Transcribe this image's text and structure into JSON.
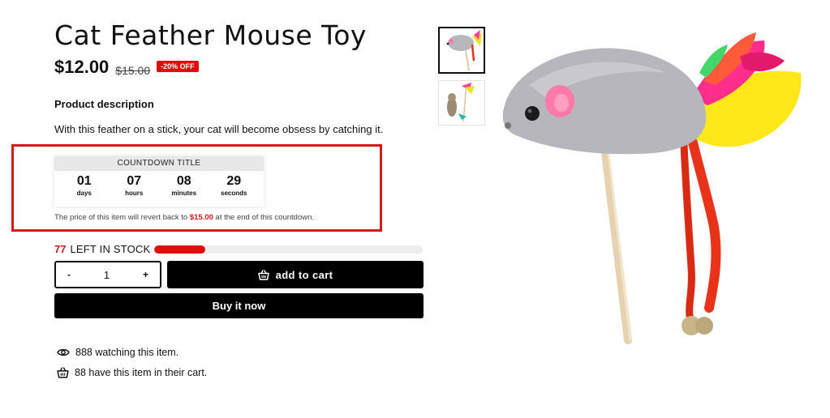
{
  "product": {
    "title": "Cat Feather Mouse Toy",
    "price": "$12.00",
    "old_price": "$15.00",
    "discount_badge": "-20% OFF"
  },
  "description": {
    "heading": "Product description",
    "text": "With this feather on a stick, your cat will become obsess by catching it."
  },
  "countdown": {
    "title": "COUNTDOWN TITLE",
    "units": [
      {
        "value": "01",
        "label": "days"
      },
      {
        "value": "07",
        "label": "hours"
      },
      {
        "value": "08",
        "label": "minutes"
      },
      {
        "value": "29",
        "label": "seconds"
      }
    ],
    "note_prefix": "The price of this item will revert back to ",
    "note_price": "$15.00",
    "note_suffix": " at the end of this countdown.",
    "highlight_color": "#d11a1a"
  },
  "stock": {
    "count": "77",
    "label": "LEFT IN STOCK",
    "level_fraction": 0.19
  },
  "purchase": {
    "qty_minus": "-",
    "qty_value": "1",
    "qty_plus": "+",
    "add_to_cart_label": "add to cart",
    "buy_now_label": "Buy it now"
  },
  "social_proof": {
    "watching": "888 watching this item.",
    "in_cart": "88 have this item in their cart."
  },
  "colors": {
    "accent_red": "#e00d0d",
    "button_black": "#000000"
  },
  "icons": {
    "cart": "basket-icon",
    "watching": "eye-icon",
    "in_cart": "basket-icon"
  }
}
